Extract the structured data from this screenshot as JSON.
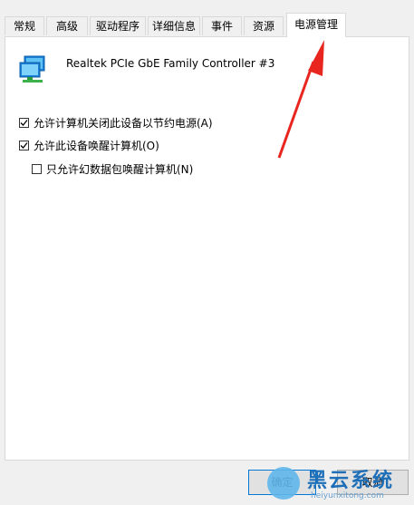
{
  "tabs": [
    {
      "label": "常规",
      "active": false
    },
    {
      "label": "高级",
      "active": false
    },
    {
      "label": "驱动程序",
      "active": false
    },
    {
      "label": "详细信息",
      "active": false
    },
    {
      "label": "事件",
      "active": false
    },
    {
      "label": "资源",
      "active": false
    },
    {
      "label": "电源管理",
      "active": true
    }
  ],
  "device": {
    "icon": "network-adapter-icon",
    "name": "Realtek PCIe GbE Family Controller #3"
  },
  "options": [
    {
      "label": "允许计算机关闭此设备以节约电源(A)",
      "checked": true
    },
    {
      "label": "允许此设备唤醒计算机(O)",
      "checked": true
    },
    {
      "label": "只允许幻数据包唤醒计算机(N)",
      "checked": false
    }
  ],
  "buttons": {
    "ok": "确定",
    "cancel": "取消"
  },
  "annotation": {
    "color": "#e8261f"
  },
  "watermark": {
    "title": "黑云系统",
    "url": "heiyunxitong.com"
  }
}
